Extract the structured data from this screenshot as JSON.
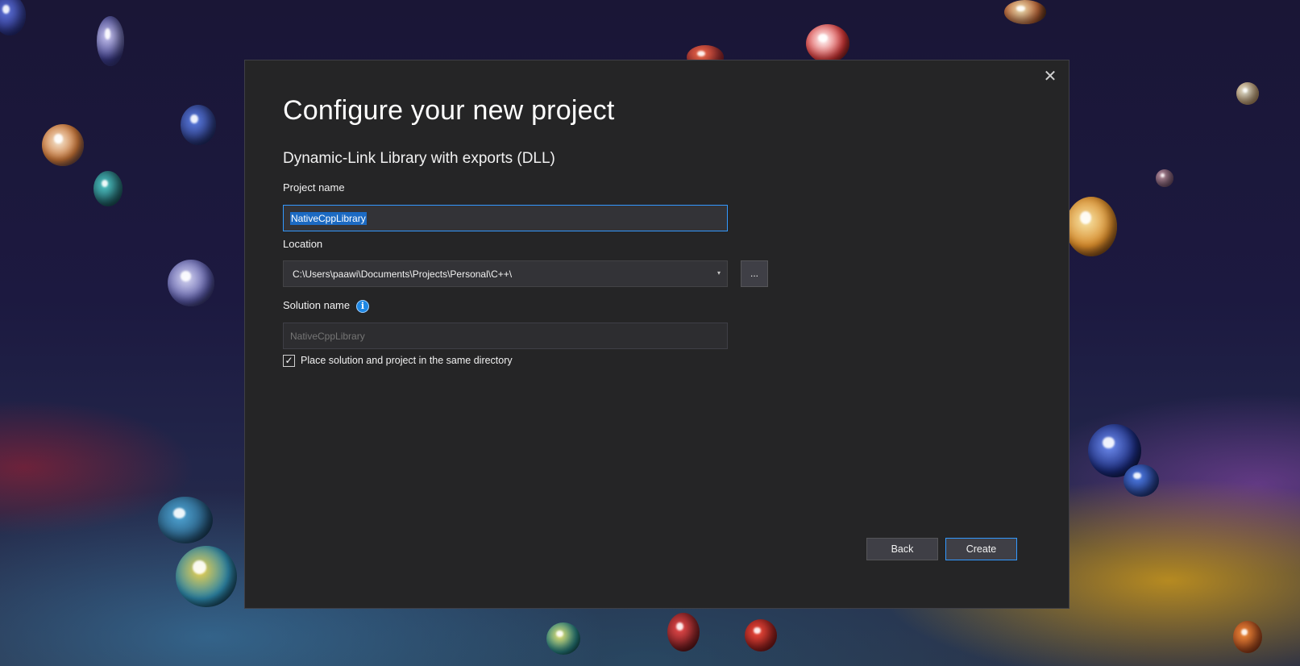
{
  "dialog": {
    "title": "Configure your new project",
    "subtitle": "Dynamic-Link Library with exports (DLL)",
    "close_glyph": "✕"
  },
  "project_name": {
    "label": "Project name",
    "value": "NativeCppLibrary"
  },
  "location": {
    "label": "Location",
    "value": "C:\\Users\\paawi\\Documents\\Projects\\Personal\\C++\\",
    "browse_label": "...",
    "dropdown_glyph": "▾"
  },
  "solution_name": {
    "label": "Solution name",
    "info_glyph": "i",
    "placeholder": "NativeCppLibrary"
  },
  "same_directory": {
    "label": "Place solution and project in the same directory",
    "checked": true,
    "check_glyph": "✓"
  },
  "buttons": {
    "back": "Back",
    "create": "Create"
  },
  "colors": {
    "dialog_background": "#252526",
    "accent": "#3399ff",
    "selection": "#1c6ac2",
    "info_icon": "#1e88e5"
  }
}
